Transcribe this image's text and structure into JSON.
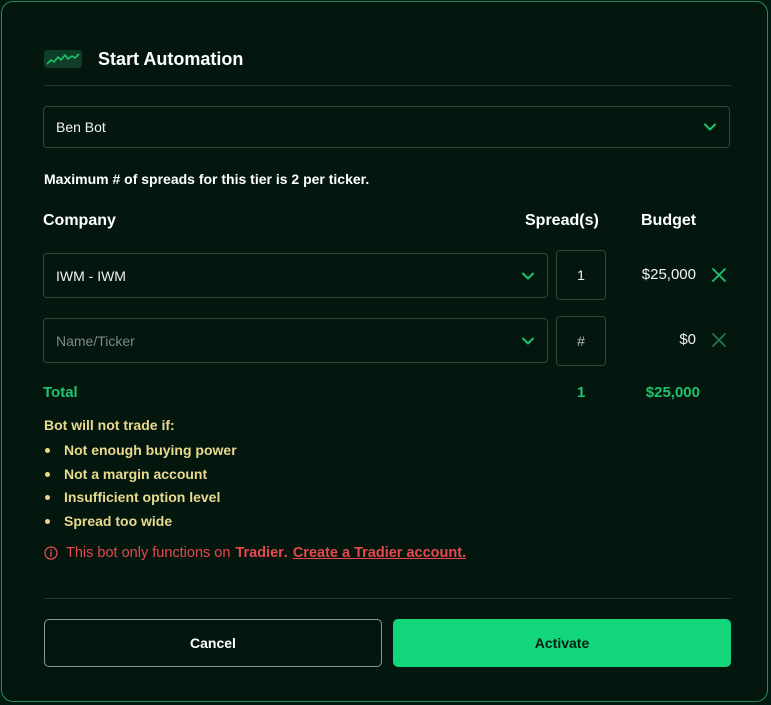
{
  "modal": {
    "title": "Start Automation",
    "icon": "chart-line-icon"
  },
  "bot_select": {
    "value": "Ben Bot"
  },
  "tier_info": "Maximum # of spreads for this tier is 2 per ticker.",
  "columns": {
    "company": "Company",
    "spreads": "Spread(s)",
    "budget": "Budget"
  },
  "rows": [
    {
      "company": "IWM - IWM",
      "spreads": "1",
      "budget": "$25,000",
      "is_placeholder": false
    },
    {
      "company": "Name/Ticker",
      "spreads": "#",
      "budget": "$0",
      "is_placeholder": true
    }
  ],
  "total": {
    "label": "Total",
    "spreads": "1",
    "budget": "$25,000"
  },
  "warnings": {
    "heading": "Bot will not trade if:",
    "items": [
      "Not enough buying power",
      "Not a margin account",
      "Insufficient option level",
      "Spread too wide"
    ]
  },
  "notice": {
    "prefix": "This bot only functions on",
    "broker": "Tradier",
    "separator": ".",
    "link": "Create a Tradier account."
  },
  "buttons": {
    "cancel": "Cancel",
    "activate": "Activate"
  },
  "colors": {
    "background": "#04170f",
    "accent_green": "#13d67a",
    "total_green": "#1ec46b",
    "warning_yellow": "#e8d98c",
    "error_red": "#e5484d",
    "border": "#2c4a3a"
  }
}
